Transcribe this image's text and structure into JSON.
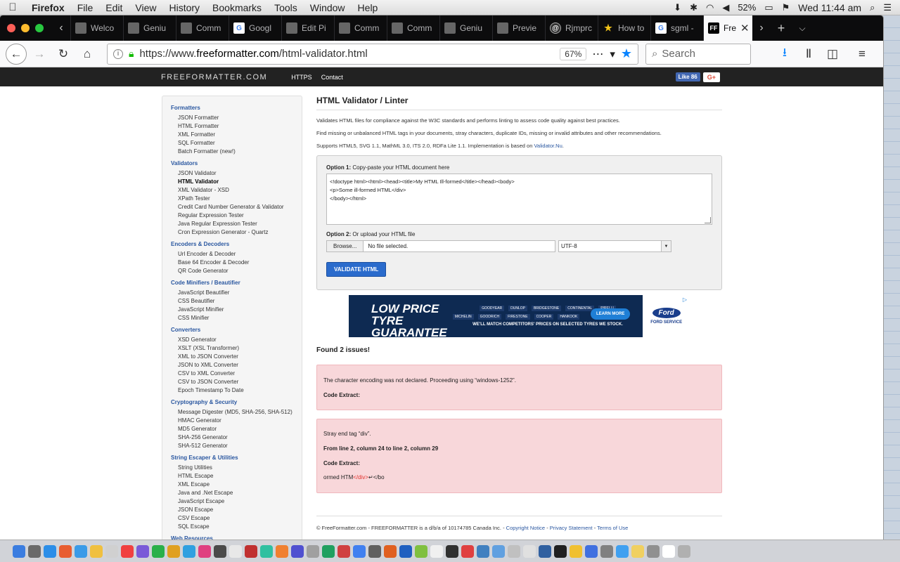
{
  "menubar": {
    "app": "Firefox",
    "items": [
      "File",
      "Edit",
      "View",
      "History",
      "Bookmarks",
      "Tools",
      "Window",
      "Help"
    ],
    "battery": "52%",
    "clock": "Wed 11:44 am"
  },
  "tabs": [
    {
      "label": "Welco",
      "icon": "page-icon"
    },
    {
      "label": "Geniu",
      "icon": "page-icon"
    },
    {
      "label": "Comm",
      "icon": "page-icon"
    },
    {
      "label": "Googl",
      "icon": "google-icon"
    },
    {
      "label": "Edit Pi",
      "icon": "page-icon"
    },
    {
      "label": "Comm",
      "icon": "page-icon"
    },
    {
      "label": "Comm",
      "icon": "page-icon"
    },
    {
      "label": "Geniu",
      "icon": "page-icon"
    },
    {
      "label": "Previe",
      "icon": "page-icon"
    },
    {
      "label": "Rjmprc",
      "icon": "page-icon"
    },
    {
      "label": "How to",
      "icon": "star-icon"
    },
    {
      "label": "sgml -",
      "icon": "google-icon"
    }
  ],
  "active_tab": {
    "label": "Fre",
    "icon": "FF"
  },
  "toolbar": {
    "url_prefix": "https://www.",
    "url_domain": "freeformatter.com",
    "url_path": "/html-validator.html",
    "zoom": "67%",
    "search_placeholder": "Search"
  },
  "site": {
    "logo": "FREEFORMATTER.COM",
    "nav": [
      "HTTPS",
      "Contact"
    ],
    "fb_like": "Like 86",
    "gplus": "G+"
  },
  "sidebar": [
    {
      "title": "Formatters",
      "items": [
        "JSON Formatter",
        "HTML Formatter",
        "XML Formatter",
        "SQL Formatter",
        "Batch Formatter (new!)"
      ]
    },
    {
      "title": "Validators",
      "items": [
        "JSON Validator",
        "HTML Validator",
        "XML Validator - XSD",
        "XPath Tester",
        "Credit Card Number Generator & Validator",
        "Regular Expression Tester",
        "Java Regular Expression Tester",
        "Cron Expression Generator - Quartz"
      ]
    },
    {
      "title": "Encoders & Decoders",
      "items": [
        "Url Encoder & Decoder",
        "Base 64 Encoder & Decoder",
        "QR Code Generator"
      ]
    },
    {
      "title": "Code Minifiers / Beautifier",
      "items": [
        "JavaScript Beautifier",
        "CSS Beautifier",
        "JavaScript Minifier",
        "CSS Minifier"
      ]
    },
    {
      "title": "Converters",
      "items": [
        "XSD Generator",
        "XSLT (XSL Transformer)",
        "XML to JSON Converter",
        "JSON to XML Converter",
        "CSV to XML Converter",
        "CSV to JSON Converter",
        "Epoch Timestamp To Date"
      ]
    },
    {
      "title": "Cryptography & Security",
      "items": [
        "Message Digester (MD5, SHA-256, SHA-512)",
        "HMAC Generator",
        "MD5 Generator",
        "SHA-256 Generator",
        "SHA-512 Generator"
      ]
    },
    {
      "title": "String Escaper & Utilities",
      "items": [
        "String Utilities",
        "HTML Escape",
        "XML Escape",
        "Java and .Net Escape",
        "JavaScript Escape",
        "JSON Escape",
        "CSV Escape",
        "SQL Escape"
      ]
    },
    {
      "title": "Web Resources",
      "items": []
    }
  ],
  "sidebar_current": "HTML Validator",
  "main": {
    "title": "HTML Validator / Linter",
    "desc1": "Validates HTML files for compliance against the W3C standards and performs linting to assess code quality against best practices.",
    "desc2": "Find missing or unbalanced HTML tags in your documents, stray characters, duplicate IDs, missing or invalid attributes and other recommendations.",
    "desc3": "Supports HTML5, SVG 1.1, MathML 3.0, ITS 2.0, RDFa Lite 1.1. Implementation is based on ",
    "desc3_link": "Validator.Nu",
    "desc3_end": ".",
    "opt1_bold": "Option 1:",
    "opt1_text": " Copy-paste your HTML document here",
    "textarea": "<!doctype html><html><head><title>My HTML Ill-formed</title></head><body>\n<p>Some ill-formed HTML</div>\n</body></html>",
    "opt2_bold": "Option 2:",
    "opt2_text": " Or upload your HTML file",
    "browse": "Browse...",
    "no_file": "No file selected.",
    "encoding": "UTF-8",
    "validate": "VALIDATE HTML"
  },
  "ad": {
    "headline": "LOW PRICE TYRE GUARANTEE",
    "brands": [
      "GOODYEAR",
      "DUNLOP",
      "BRIDGESTONE",
      "CONTINENTAL",
      "PIRELLI",
      "MICHELIN",
      "GOODRICH",
      "FIRESTONE",
      "COOPER",
      "HANKOOK"
    ],
    "tagline": "WE'LL MATCH COMPETITORS' PRICES ON SELECTED TYRES WE STOCK.",
    "cta": "LEARN MORE",
    "ford": "Ford",
    "ford_service": "FORD SERVICE"
  },
  "results": {
    "heading": "Found 2 issues!",
    "issue1": {
      "message": "The character encoding was not declared. Proceeding using “windows-1252”.",
      "extract_label": "Code Extract:"
    },
    "issue2": {
      "message": "Stray end tag “div”.",
      "location": "From line 2, column 24 to line 2, column 29",
      "extract_label": "Code Extract:",
      "extract_before": "ormed HTM",
      "extract_mark": "</div>",
      "extract_after": "↵</bo"
    }
  },
  "footer": {
    "text": "© FreeFormatter.com - FREEFORMATTER is a d/b/a of 10174785 Canada Inc. - ",
    "links": [
      "Copyright Notice",
      "Privacy Statement",
      "Terms of Use"
    ]
  }
}
